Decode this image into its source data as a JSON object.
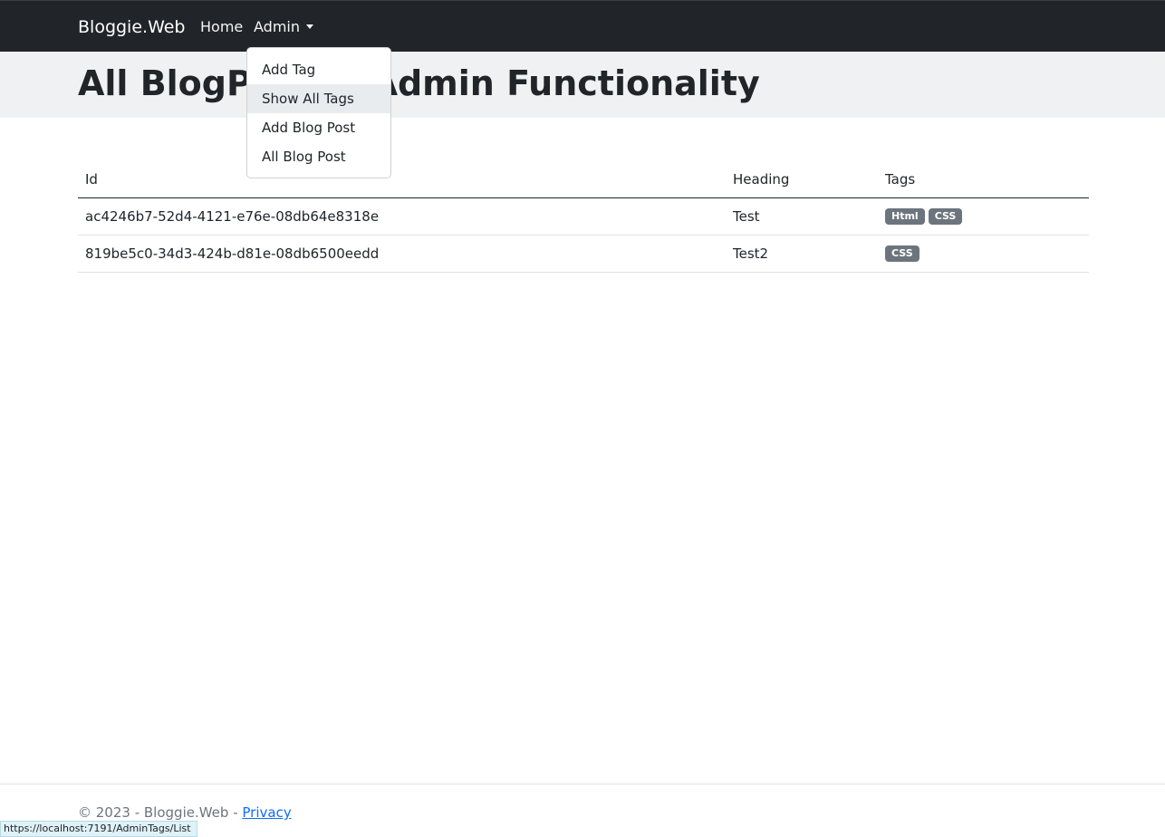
{
  "navbar": {
    "brand": "Bloggie.Web",
    "home": "Home",
    "admin": "Admin"
  },
  "dropdown": {
    "items": [
      {
        "label": "Add Tag"
      },
      {
        "label": "Show All Tags"
      },
      {
        "label": "Add Blog Post"
      },
      {
        "label": "All Blog Post"
      }
    ],
    "highlighted": "Show All Tags"
  },
  "hero": {
    "title": "All BlogPosts - Admin Functionality"
  },
  "table": {
    "headers": [
      "Id",
      "Heading",
      "Tags"
    ],
    "rows": [
      {
        "id": "ac4246b7-52d4-4121-e76e-08db64e8318e",
        "heading": "Test",
        "tags": [
          "Html",
          "CSS"
        ]
      },
      {
        "id": "819be5c0-34d3-424b-d81e-08db6500eedd",
        "heading": "Test2",
        "tags": [
          "CSS"
        ]
      }
    ]
  },
  "footer": {
    "prefix": "© 2023 - Bloggie.Web - ",
    "privacy": "Privacy"
  },
  "statusbar": {
    "url": "https://localhost:7191/AdminTags/List"
  },
  "colors": {
    "navbar_bg": "#212529",
    "hero_bg": "#f0f1f2",
    "badge_bg": "#6c757d",
    "link": "#0d6efd",
    "dropdown_active_bg": "#e9ecef"
  }
}
